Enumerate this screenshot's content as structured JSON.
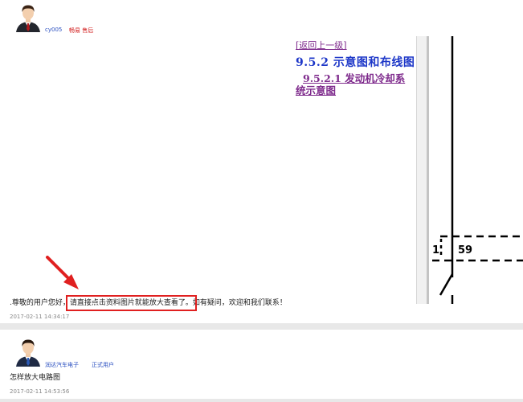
{
  "post1": {
    "username": "cy005",
    "badge": "畅易  售后",
    "doc": {
      "back_link": "[返回上一级]",
      "heading": "9.5.2 示意图和布线图",
      "subheading_line1": "9.5.2.1 发动机冷却系",
      "subheading_line2": "统示意图",
      "diagram_label_left": "1",
      "diagram_label_right": "59"
    },
    "message_prefix": ".尊敬的用户您好，",
    "message_highlight": "请直接点击资料图片就能放大查看了。",
    "message_suffix": "如有疑问，欢迎和我们联系！",
    "timestamp": "2017-02-11  14:34:17"
  },
  "post2": {
    "username": "润达汽车电子",
    "badge": "正式用户",
    "text": "怎样放大电路图",
    "timestamp": "2017-02-11  14:53:56"
  },
  "colors": {
    "annotation_red": "#e02020",
    "username_blue": "#2a4fc0",
    "badge_red": "#d21d1d"
  }
}
